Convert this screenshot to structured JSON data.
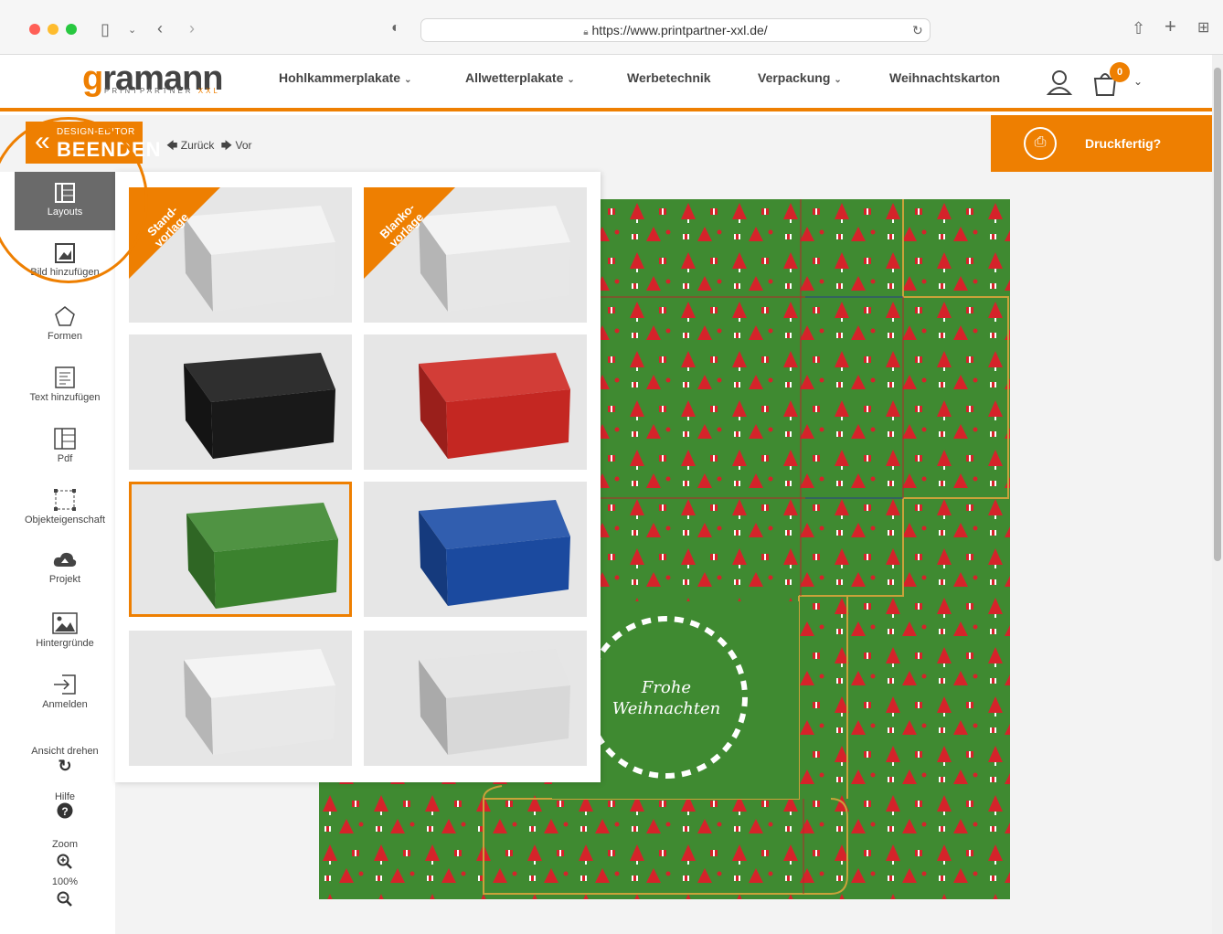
{
  "browser": {
    "url": "https://www.printpartner-xxl.de/"
  },
  "header": {
    "logo_main_accent": "g",
    "logo_main_rest": "ramann",
    "logo_sub": "PRINTPARTNER",
    "logo_sub_accent": "XXL",
    "nav": [
      {
        "label": "Hohlkammerplakate",
        "has_dropdown": true
      },
      {
        "label": "Allwetterplakate",
        "has_dropdown": true
      },
      {
        "label": "Werbetechnik",
        "has_dropdown": false
      },
      {
        "label": "Verpackung",
        "has_dropdown": true
      },
      {
        "label": "Weihnachtskarton",
        "has_dropdown": false
      }
    ],
    "cart_count": "0"
  },
  "editor": {
    "exit_small": "DESIGN-EDITOR",
    "exit_big": "BEENDEN",
    "undo": "Zurück",
    "redo": "Vor",
    "print_ready": "Druckfertig?"
  },
  "sidebar": {
    "items": [
      {
        "label": "Layouts",
        "icon": "layout-icon",
        "active": true
      },
      {
        "label": "Bild hinzufügen",
        "icon": "image-add-icon"
      },
      {
        "label": "Formen",
        "icon": "pentagon-icon"
      },
      {
        "label": "Text hinzufügen",
        "icon": "text-icon"
      },
      {
        "label": "Pdf",
        "icon": "pdf-icon"
      },
      {
        "label": "Objekteigenschaft",
        "icon": "object-icon"
      },
      {
        "label": "Projekt",
        "icon": "cloud-icon"
      },
      {
        "label": "Hintergründe",
        "icon": "background-icon"
      },
      {
        "label": "Anmelden",
        "icon": "login-icon"
      }
    ],
    "rotate_label": "Ansicht drehen",
    "help_label": "Hilfe",
    "zoom_label": "Zoom",
    "zoom_value": "100%"
  },
  "layouts": {
    "tiles": [
      {
        "name": "standard-template",
        "ribbon": "Stand-\nvorlage",
        "box_color": "#f4f4f4",
        "selected": false
      },
      {
        "name": "blank-template",
        "ribbon": "Blanko-\nvorlage",
        "box_color": "#f4f4f4",
        "selected": false
      },
      {
        "name": "black-box",
        "box_color": "#1b1b1b",
        "selected": false
      },
      {
        "name": "red-gift-box",
        "box_color": "#cf2a24",
        "selected": false
      },
      {
        "name": "green-christmas-box",
        "box_color": "#3f8a31",
        "selected": true
      },
      {
        "name": "blue-snow-box",
        "box_color": "#1d4fa8",
        "selected": false
      },
      {
        "name": "white-print-box",
        "box_color": "#f5f5f5",
        "selected": false
      },
      {
        "name": "marble-box",
        "box_color": "#e4e4e4",
        "selected": false
      }
    ]
  },
  "design": {
    "greeting_line1": "Frohe",
    "greeting_line2": "Weihnachten",
    "background_color": "#3f8a31",
    "pattern_color": "#d5232a",
    "cutline_color": "#c9a23a"
  },
  "colors": {
    "accent": "#ee7f01"
  }
}
